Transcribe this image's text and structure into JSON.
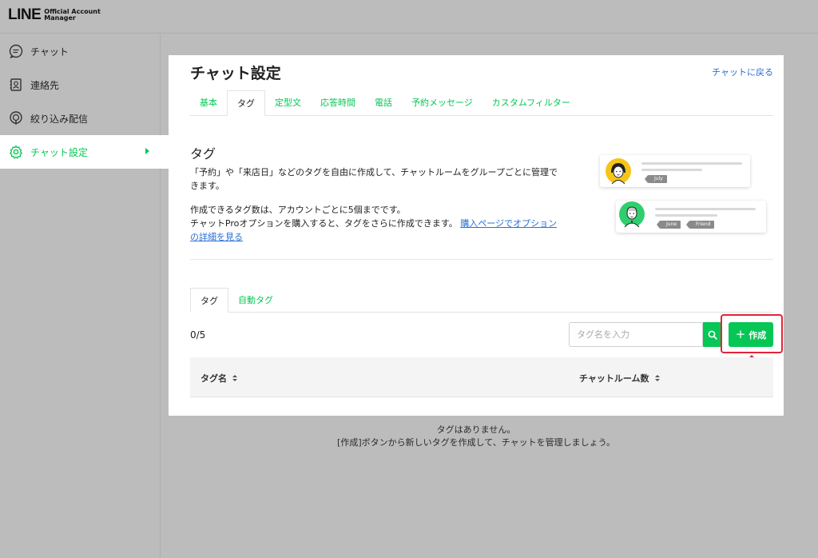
{
  "header": {
    "logo_main": "LINE",
    "logo_sub1": "Official Account",
    "logo_sub2": "Manager"
  },
  "sidebar": {
    "items": [
      {
        "label": "チャット",
        "icon": "chat-bubble-icon"
      },
      {
        "label": "連絡先",
        "icon": "contact-card-icon"
      },
      {
        "label": "絞り込み配信",
        "icon": "broadcast-icon"
      },
      {
        "label": "チャット設定",
        "icon": "gear-icon",
        "active": true
      }
    ]
  },
  "main": {
    "title": "チャット設定",
    "back_link": "チャットに戻る",
    "tabs": [
      "基本",
      "タグ",
      "定型文",
      "応答時間",
      "電話",
      "予約メッセージ",
      "カスタムフィルター"
    ],
    "active_tab": "タグ",
    "section_title": "タグ",
    "desc_line1": "「予約」や「来店日」などのタグを自由に作成して、チャットルームをグループごとに管理で",
    "desc_line2": "きます。",
    "limit_text": "作成できるタグ数は、アカウントごとに5個までです。",
    "pro_text": "チャットProオプションを購入すると、タグをさらに作成できます。",
    "pro_link_1": "購入ページでオプション",
    "pro_link_2": "の詳細を見る",
    "illustration": {
      "tag1": "July",
      "tag2": "June",
      "tag3": "Friend"
    },
    "subtabs": [
      "タグ",
      "自動タグ"
    ],
    "count": "0/5",
    "search_placeholder": "タグ名を入力",
    "create_label": "作成",
    "table": {
      "col_name": "タグ名",
      "col_rooms": "チャットルーム数"
    },
    "empty_line1": "タグはありません。",
    "empty_line2": "[作成]ボタンから新しいタグを作成して、チャットを管理しましょう。"
  },
  "colors": {
    "accent": "#06c755",
    "link": "#2a6fd6",
    "highlight": "#e0263a"
  }
}
